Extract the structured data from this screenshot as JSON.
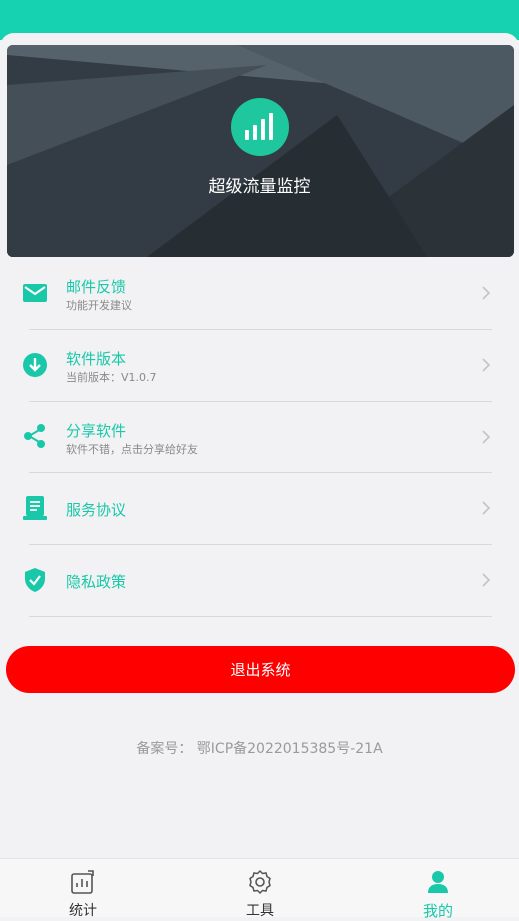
{
  "app": {
    "title": "超级流量监控"
  },
  "menu": {
    "items": [
      {
        "title": "邮件反馈",
        "subtitle": "功能开发建议",
        "icon": "mail-icon"
      },
      {
        "title": "软件版本",
        "subtitle": "当前版本：V1.0.7",
        "icon": "download-icon"
      },
      {
        "title": "分享软件",
        "subtitle": "软件不错，点击分享给好友",
        "icon": "share-icon"
      },
      {
        "title": "服务协议",
        "subtitle": "",
        "icon": "document-icon"
      },
      {
        "title": "隐私政策",
        "subtitle": "",
        "icon": "shield-icon"
      }
    ]
  },
  "logout": {
    "label": "退出系统"
  },
  "footer": {
    "icp": "备案号：  鄂ICP备2022015385号-21A"
  },
  "tabbar": {
    "tabs": [
      {
        "label": "统计",
        "icon": "stats-icon",
        "active": false
      },
      {
        "label": "工具",
        "icon": "gear-icon",
        "active": false
      },
      {
        "label": "我的",
        "icon": "person-icon",
        "active": true
      }
    ]
  },
  "colors": {
    "accent": "#19c8a8",
    "header": "#16d2b0",
    "danger": "#ff0000"
  }
}
